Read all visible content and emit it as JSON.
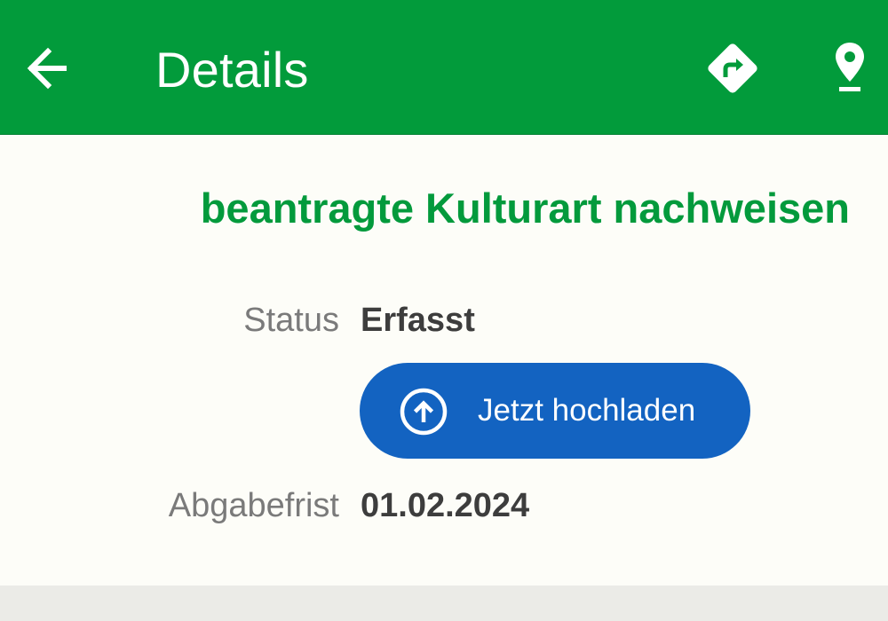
{
  "app_bar": {
    "title": "Details",
    "back_icon": "arrow-back-icon",
    "directions_icon": "directions-icon",
    "location_icon": "location-pin-icon",
    "background_color": "#029b3b"
  },
  "task": {
    "title": "beantragte Kulturart nachweisen",
    "title_color": "#039a3c"
  },
  "fields": {
    "status_label": "Status",
    "status_value": "Erfasst",
    "deadline_label": "Abgabefrist",
    "deadline_value": "01.02.2024"
  },
  "upload_button": {
    "label": "Jetzt hochladen",
    "icon": "upload-circle-icon",
    "color": "#1363c1"
  }
}
